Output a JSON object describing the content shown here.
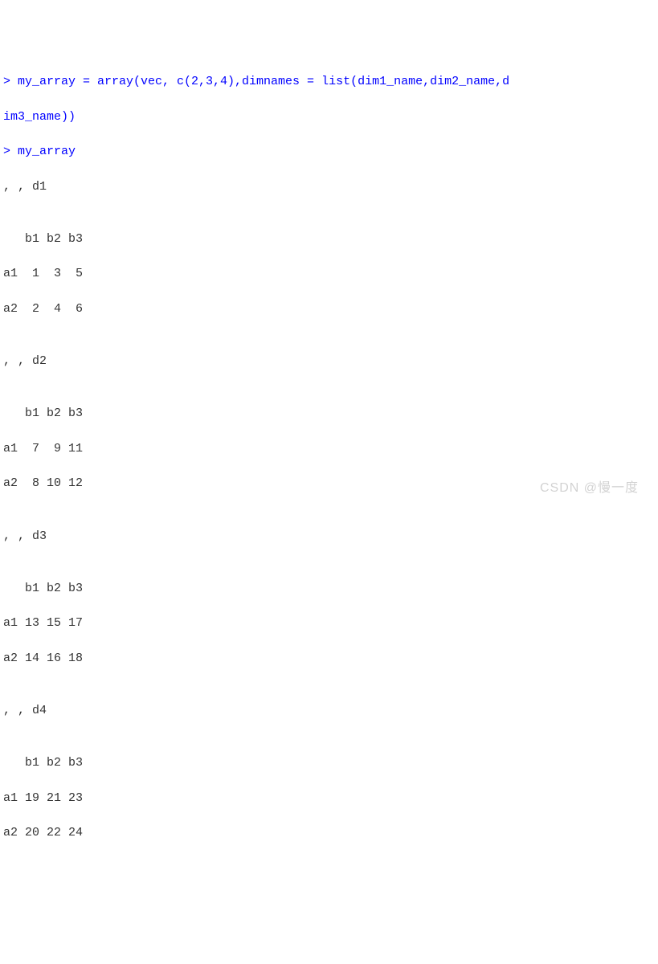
{
  "lines": {
    "input1a": "> my_array = array(vec, c(2,3,4),dimnames = list(dim1_name,dim2_name,d",
    "input1b": "im3_name))",
    "input2": "> my_array",
    "slice1_hdr": ", , d1",
    "blank": "",
    "slice1_colh": "   b1 b2 b3",
    "slice1_r1": "a1  1  3  5",
    "slice1_r2": "a2  2  4  6",
    "slice2_hdr": ", , d2",
    "slice2_colh": "   b1 b2 b3",
    "slice2_r1": "a1  7  9 11",
    "slice2_r2": "a2  8 10 12",
    "slice3_hdr": ", , d3",
    "slice3_colh": "   b1 b2 b3",
    "slice3_r1": "a1 13 15 17",
    "slice3_r2": "a2 14 16 18",
    "slice4_hdr": ", , d4",
    "slice4_colh": "   b1 b2 b3",
    "slice4_r1": "a1 19 21 23",
    "slice4_r2": "a2 20 22 24"
  },
  "watermark": "CSDN @慢一度"
}
